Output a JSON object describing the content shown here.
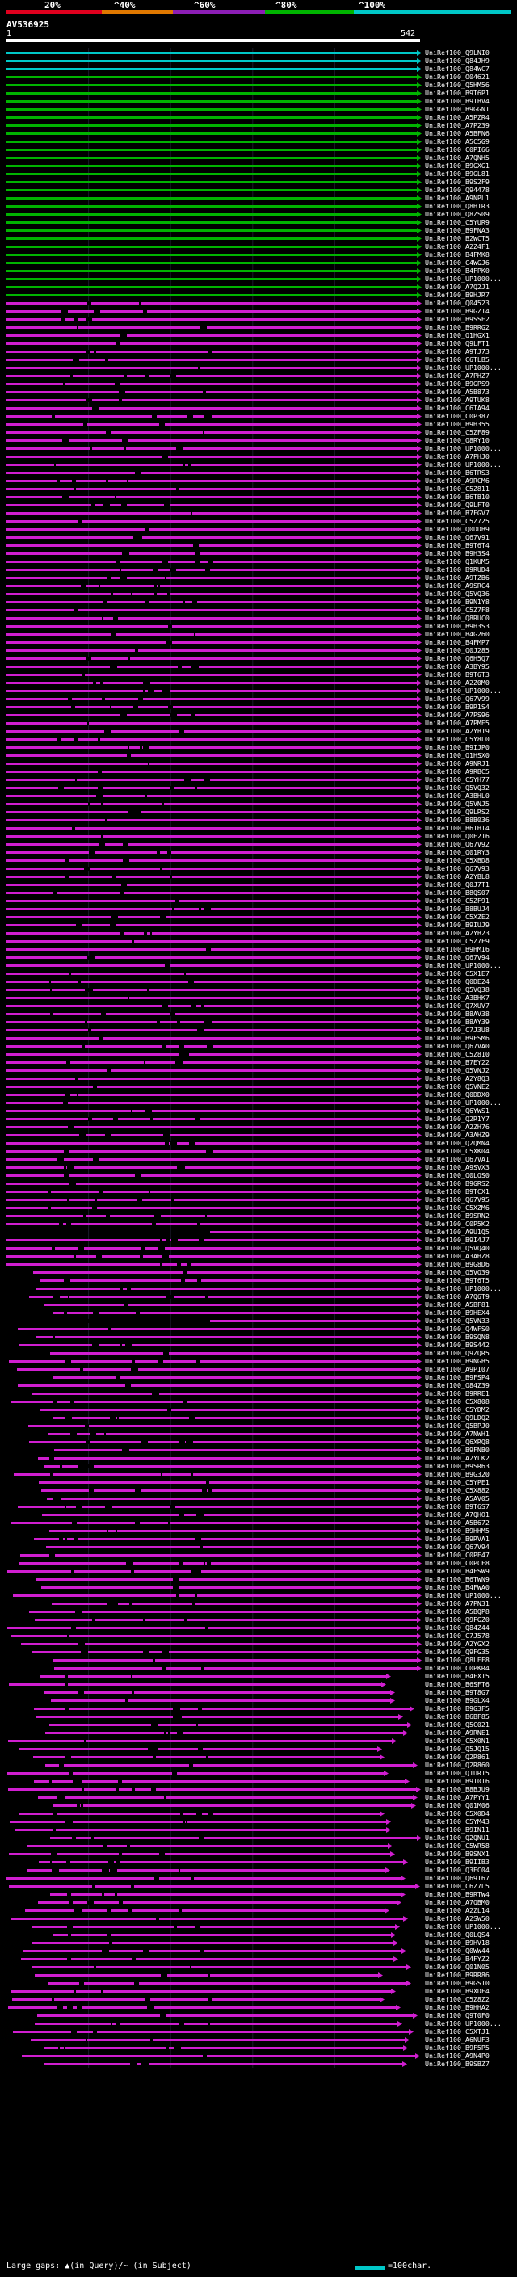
{
  "legend": {
    "labels": [
      "20%",
      "^40%",
      "^60%",
      "^80%",
      "^100%"
    ],
    "colors": [
      "#e0001e",
      "#e07800",
      "#8c1eb4",
      "#00b400",
      "#00c8c8"
    ]
  },
  "query": {
    "id": "AV536925",
    "start": "1",
    "end": "542"
  },
  "hits": [
    {
      "label": "UniRef100_Q9LNI0",
      "color": "cyan"
    },
    {
      "label": "UniRef100_Q84JH9",
      "color": "cyan"
    },
    {
      "label": "UniRef100_Q84WC7",
      "color": "cyan"
    },
    {
      "label": "UniRef100_O04621",
      "color": "green"
    },
    {
      "label": "UniRef100_Q5HM56",
      "color": "green"
    },
    {
      "label": "UniRef100_B9T6P1",
      "color": "green"
    },
    {
      "label": "UniRef100_B9IBV4",
      "color": "green"
    },
    {
      "label": "UniRef100_B9GGN1",
      "color": "green"
    },
    {
      "label": "UniRef100_A5PZR4",
      "color": "green"
    },
    {
      "label": "UniRef100_A7P239",
      "color": "green"
    },
    {
      "label": "UniRef100_A5BFN6",
      "color": "green"
    },
    {
      "label": "UniRef100_A5C5G9",
      "color": "green"
    },
    {
      "label": "UniRef100_C0PI66",
      "color": "green"
    },
    {
      "label": "UniRef100_A7QNH5",
      "color": "green"
    },
    {
      "label": "UniRef100_B9GXG1",
      "color": "green"
    },
    {
      "label": "UniRef100_B9GL81",
      "color": "green"
    },
    {
      "label": "UniRef100_B9S2F9",
      "color": "green"
    },
    {
      "label": "UniRef100_Q94478",
      "color": "green"
    },
    {
      "label": "UniRef100_A9NPL1",
      "color": "green"
    },
    {
      "label": "UniRef100_Q8H1R3",
      "color": "green"
    },
    {
      "label": "UniRef100_Q8ZS09",
      "color": "green"
    },
    {
      "label": "UniRef100_C5YUR9",
      "color": "green"
    },
    {
      "label": "UniRef100_B9FNA3",
      "color": "green"
    },
    {
      "label": "UniRef100_B2WCT5",
      "color": "green"
    },
    {
      "label": "UniRef100_A2Z4F1",
      "color": "green"
    },
    {
      "label": "UniRef100_B4FMK8",
      "color": "green"
    },
    {
      "label": "UniRef100_C4WGJ6",
      "color": "green"
    },
    {
      "label": "UniRef100_B4FPK0",
      "color": "green"
    },
    {
      "label": "UniRef100_UP1000...",
      "color": "green"
    },
    {
      "label": "UniRef100_A7Q2J1",
      "color": "green"
    },
    {
      "label": "UniRef100_B9HJR7",
      "color": "green"
    },
    {
      "label": "UniRef100_Q04523",
      "color": "magenta"
    },
    {
      "label": "UniRef100_B9GZ14",
      "color": "magenta"
    },
    {
      "label": "UniRef100_B9SSE2",
      "color": "magenta"
    },
    {
      "label": "UniRef100_B9RRG2",
      "color": "magenta"
    },
    {
      "label": "UniRef100_Q1HGX1",
      "color": "magenta"
    },
    {
      "label": "UniRef100_Q9LFT1",
      "color": "magenta"
    },
    {
      "label": "UniRef100_A9TJ73",
      "color": "magenta"
    },
    {
      "label": "UniRef100_C6TLB5",
      "color": "magenta"
    },
    {
      "label": "UniRef100_UP1000...",
      "color": "magenta"
    },
    {
      "label": "UniRef100_A7PHZ7",
      "color": "magenta"
    },
    {
      "label": "UniRef100_B9GPS9",
      "color": "magenta"
    },
    {
      "label": "UniRef100_A5B873",
      "color": "magenta"
    },
    {
      "label": "UniRef100_A9TUK8",
      "color": "magenta"
    },
    {
      "label": "UniRef100_C6TA94",
      "color": "magenta"
    },
    {
      "label": "UniRef100_C0P387",
      "color": "magenta"
    },
    {
      "label": "UniRef100_B9H355",
      "color": "magenta"
    },
    {
      "label": "UniRef100_C5ZF89",
      "color": "magenta"
    },
    {
      "label": "UniRef100_Q8RY10",
      "color": "magenta"
    },
    {
      "label": "UniRef100_UP1000...",
      "color": "magenta"
    },
    {
      "label": "UniRef100_A7PHJ0",
      "color": "magenta"
    },
    {
      "label": "UniRef100_UP1000...",
      "color": "magenta"
    },
    {
      "label": "UniRef100_B6TRS3",
      "color": "magenta"
    },
    {
      "label": "UniRef100_A9RCM6",
      "color": "magenta"
    },
    {
      "label": "UniRef100_C5Z811",
      "color": "magenta"
    },
    {
      "label": "UniRef100_B6TB10",
      "color": "magenta"
    },
    {
      "label": "UniRef100_Q9LFT0",
      "color": "magenta"
    },
    {
      "label": "UniRef100_B7FGV7",
      "color": "magenta"
    },
    {
      "label": "UniRef100_C5Z725",
      "color": "magenta"
    },
    {
      "label": "UniRef100_Q0DDB9",
      "color": "magenta"
    },
    {
      "label": "UniRef100_Q67V91",
      "color": "magenta"
    },
    {
      "label": "UniRef100_B9T6T4",
      "color": "magenta"
    },
    {
      "label": "UniRef100_B9H3S4",
      "color": "magenta"
    },
    {
      "label": "UniRef100_Q1KUM5",
      "color": "magenta"
    },
    {
      "label": "UniRef100_B9RUD4",
      "color": "magenta"
    },
    {
      "label": "UniRef100_A9TZB6",
      "color": "magenta"
    },
    {
      "label": "UniRef100_A9SRC4",
      "color": "magenta"
    },
    {
      "label": "UniRef100_Q5VQ36",
      "color": "magenta"
    },
    {
      "label": "UniRef100_B9N1Y8",
      "color": "magenta"
    },
    {
      "label": "UniRef100_C5Z7F8",
      "color": "magenta"
    },
    {
      "label": "UniRef100_Q8RUC0",
      "color": "magenta"
    },
    {
      "label": "UniRef100_B9H3S3",
      "color": "magenta"
    },
    {
      "label": "UniRef100_B4G260",
      "color": "magenta"
    },
    {
      "label": "UniRef100_B4FMP7",
      "color": "magenta"
    },
    {
      "label": "UniRef100_Q0J285",
      "color": "magenta"
    },
    {
      "label": "UniRef100_Q6H5Q7",
      "color": "magenta"
    },
    {
      "label": "UniRef100_A3BY95",
      "color": "magenta"
    },
    {
      "label": "UniRef100_B9T6T3",
      "color": "magenta"
    },
    {
      "label": "UniRef100_A2Z0M0",
      "color": "magenta"
    },
    {
      "label": "UniRef100_UP1000...",
      "color": "magenta"
    },
    {
      "label": "UniRef100_Q67V99",
      "color": "magenta"
    },
    {
      "label": "UniRef100_B9R1S4",
      "color": "magenta"
    },
    {
      "label": "UniRef100_A7PS96",
      "color": "magenta"
    },
    {
      "label": "UniRef100_A7PME5",
      "color": "magenta"
    },
    {
      "label": "UniRef100_A2YB19",
      "color": "magenta"
    },
    {
      "label": "UniRef100_C5Y8L0",
      "color": "magenta"
    },
    {
      "label": "UniRef100_B9IJP0",
      "color": "magenta"
    },
    {
      "label": "UniRef100_Q1HSX0",
      "color": "magenta"
    },
    {
      "label": "UniRef100_A9NRJ1",
      "color": "magenta"
    },
    {
      "label": "UniRef100_A9RBC5",
      "color": "magenta"
    },
    {
      "label": "UniRef100_C5YH77",
      "color": "magenta"
    },
    {
      "label": "UniRef100_Q5VQ32",
      "color": "magenta"
    },
    {
      "label": "UniRef100_A3BHL0",
      "color": "magenta"
    },
    {
      "label": "UniRef100_Q5VNJ5",
      "color": "magenta"
    },
    {
      "label": "UniRef100_Q9LRS2",
      "color": "magenta"
    },
    {
      "label": "UniRef100_B8B036",
      "color": "magenta"
    },
    {
      "label": "UniRef100_B6THT4",
      "color": "magenta"
    },
    {
      "label": "UniRef100_Q0E216",
      "color": "magenta"
    },
    {
      "label": "UniRef100_Q67V92",
      "color": "magenta"
    },
    {
      "label": "UniRef100_Q01RY3",
      "color": "magenta"
    },
    {
      "label": "UniRef100_C5XBD8",
      "color": "magenta"
    },
    {
      "label": "UniRef100_Q67V93",
      "color": "magenta"
    },
    {
      "label": "UniRef100_A2YBL8",
      "color": "magenta"
    },
    {
      "label": "UniRef100_Q0J7T1",
      "color": "magenta"
    },
    {
      "label": "UniRef100_B8QS07",
      "color": "magenta"
    },
    {
      "label": "UniRef100_C5ZF91",
      "color": "magenta"
    },
    {
      "label": "UniRef100_B8BUJ4",
      "color": "magenta"
    },
    {
      "label": "UniRef100_C5XZE2",
      "color": "magenta"
    },
    {
      "label": "UniRef100_B9IUJ9",
      "color": "magenta"
    },
    {
      "label": "UniRef100_A2YB23",
      "color": "magenta"
    },
    {
      "label": "UniRef100_C5Z7F9",
      "color": "magenta"
    },
    {
      "label": "UniRef100_B9HMI6",
      "color": "magenta"
    },
    {
      "label": "UniRef100_Q67V94",
      "color": "magenta"
    },
    {
      "label": "UniRef100_UP1000...",
      "color": "magenta"
    },
    {
      "label": "UniRef100_C5X1E7",
      "color": "magenta"
    },
    {
      "label": "UniRef100_Q0DE24",
      "color": "magenta"
    },
    {
      "label": "UniRef100_Q5VQ38",
      "color": "magenta"
    },
    {
      "label": "UniRef100_A3BHK7",
      "color": "magenta"
    },
    {
      "label": "UniRef100_Q7XUV7",
      "color": "magenta"
    },
    {
      "label": "UniRef100_B8AV38",
      "color": "magenta"
    },
    {
      "label": "UniRef100_B8AY39",
      "color": "magenta"
    },
    {
      "label": "UniRef100_C7J3U8",
      "color": "magenta"
    },
    {
      "label": "UniRef100_B9FSM6",
      "color": "magenta"
    },
    {
      "label": "UniRef100_Q67VA0",
      "color": "magenta"
    },
    {
      "label": "UniRef100_C5Z810",
      "color": "magenta"
    },
    {
      "label": "UniRef100_B7EY22",
      "color": "magenta"
    },
    {
      "label": "UniRef100_Q5VNJ2",
      "color": "magenta"
    },
    {
      "label": "UniRef100_A2Y8Q3",
      "color": "magenta"
    },
    {
      "label": "UniRef100_Q5VNE2",
      "color": "magenta"
    },
    {
      "label": "UniRef100_Q0DDX0",
      "color": "magenta"
    },
    {
      "label": "UniRef100_UP1000...",
      "color": "magenta"
    },
    {
      "label": "UniRef100_Q6YWS1",
      "color": "magenta"
    },
    {
      "label": "UniRef100_Q2R1Y7",
      "color": "magenta"
    },
    {
      "label": "UniRef100_A2ZH76",
      "color": "magenta"
    },
    {
      "label": "UniRef100_A3AHZ9",
      "color": "magenta"
    },
    {
      "label": "UniRef100_Q2QMN4",
      "color": "magenta"
    },
    {
      "label": "UniRef100_C5XK04",
      "color": "magenta"
    },
    {
      "label": "UniRef100_Q67VA1",
      "color": "magenta"
    },
    {
      "label": "UniRef100_A9SVX3",
      "color": "magenta"
    },
    {
      "label": "UniRef100_Q0LQS0",
      "color": "magenta"
    },
    {
      "label": "UniRef100_B9GRS2",
      "color": "magenta"
    },
    {
      "label": "UniRef100_B9TCX1",
      "color": "magenta"
    },
    {
      "label": "UniRef100_Q67V95",
      "color": "magenta"
    },
    {
      "label": "UniRef100_C5XZM6",
      "color": "magenta"
    },
    {
      "label": "UniRef100_B9SRN2",
      "color": "magenta"
    },
    {
      "label": "UniRef100_C0P5K2",
      "color": "magenta"
    },
    {
      "label": "UniRef100_A9U1Q5",
      "color": "magenta"
    },
    {
      "label": "UniRef100_B9I4J7",
      "color": "magenta"
    },
    {
      "label": "UniRef100_Q5VQ40",
      "color": "magenta"
    },
    {
      "label": "UniRef100_A3AHZ8",
      "color": "magenta"
    },
    {
      "label": "UniRef100_B9G8D6",
      "color": "magenta"
    },
    {
      "label": "UniRef100_Q5VQ39",
      "color": "magenta"
    },
    {
      "label": "UniRef100_B9T6T5",
      "color": "magenta"
    },
    {
      "label": "UniRef100_UP1000...",
      "color": "magenta"
    },
    {
      "label": "UniRef100_A7Q6T9",
      "color": "magenta"
    },
    {
      "label": "UniRef100_A5BF81",
      "color": "magenta"
    },
    {
      "label": "UniRef100_B9HEX4",
      "color": "magenta"
    },
    {
      "label": "UniRef100_Q5VN33",
      "color": "magenta"
    },
    {
      "label": "UniRef100_Q4WFS0",
      "color": "magenta"
    },
    {
      "label": "UniRef100_B9SQN8",
      "color": "magenta"
    },
    {
      "label": "UniRef100_B9S442",
      "color": "magenta"
    },
    {
      "label": "UniRef100_Q9ZQR5",
      "color": "magenta"
    },
    {
      "label": "UniRef100_B9NGB5",
      "color": "magenta"
    },
    {
      "label": "UniRef100_A9PI07",
      "color": "magenta"
    },
    {
      "label": "UniRef100_B9FSP4",
      "color": "magenta"
    },
    {
      "label": "UniRef100_Q84Z39",
      "color": "magenta"
    },
    {
      "label": "UniRef100_B9RRE1",
      "color": "magenta"
    },
    {
      "label": "UniRef100_C5X808",
      "color": "magenta"
    },
    {
      "label": "UniRef100_C5YDM2",
      "color": "magenta"
    },
    {
      "label": "UniRef100_Q9LDQ2",
      "color": "magenta"
    },
    {
      "label": "UniRef100_Q5BPJ0",
      "color": "magenta"
    },
    {
      "label": "UniRef100_A7NWH1",
      "color": "magenta"
    },
    {
      "label": "UniRef100_Q6XRQ8",
      "color": "magenta"
    },
    {
      "label": "UniRef100_B9FNB0",
      "color": "magenta"
    },
    {
      "label": "UniRef100_A2YLK2",
      "color": "magenta"
    },
    {
      "label": "UniRef100_B9SR63",
      "color": "magenta"
    },
    {
      "label": "UniRef100_B9G320",
      "color": "magenta"
    },
    {
      "label": "UniRef100_C5YPE1",
      "color": "magenta"
    },
    {
      "label": "UniRef100_C5X882",
      "color": "magenta"
    },
    {
      "label": "UniRef100_A5AV05",
      "color": "magenta"
    },
    {
      "label": "UniRef100_B9T6S7",
      "color": "magenta"
    },
    {
      "label": "UniRef100_A7QHO1",
      "color": "magenta"
    },
    {
      "label": "UniRef100_A5B672",
      "color": "magenta"
    },
    {
      "label": "UniRef100_B9HHM5",
      "color": "magenta"
    },
    {
      "label": "UniRef100_B9RVA1",
      "color": "magenta"
    },
    {
      "label": "UniRef100_Q67V94",
      "color": "magenta"
    },
    {
      "label": "UniRef100_C0PE47",
      "color": "magenta"
    },
    {
      "label": "UniRef100_C0PCF8",
      "color": "magenta"
    },
    {
      "label": "UniRef100_B4FSW9",
      "color": "magenta"
    },
    {
      "label": "UniRef100_B6TWN9",
      "color": "magenta"
    },
    {
      "label": "UniRef100_B4FWA0",
      "color": "magenta"
    },
    {
      "label": "UniRef100_UP1000...",
      "color": "magenta"
    },
    {
      "label": "UniRef100_A7PN31",
      "color": "magenta"
    },
    {
      "label": "UniRef100_A5BQP8",
      "color": "magenta"
    },
    {
      "label": "UniRef100_Q9FGZ0",
      "color": "magenta"
    },
    {
      "label": "UniRef100_Q84Z44",
      "color": "magenta"
    },
    {
      "label": "UniRef100_C7J578",
      "color": "magenta"
    },
    {
      "label": "UniRef100_A2YGX2",
      "color": "magenta"
    },
    {
      "label": "UniRef100_Q9FG35",
      "color": "magenta"
    },
    {
      "label": "UniRef100_Q8LEF8",
      "color": "magenta"
    },
    {
      "label": "UniRef100_C0PKR4",
      "color": "magenta"
    },
    {
      "label": "UniRef100_B4FX15",
      "color": "magenta"
    },
    {
      "label": "UniRef100_B6SFT6",
      "color": "magenta"
    },
    {
      "label": "UniRef100_B9T8G7",
      "color": "magenta"
    },
    {
      "label": "UniRef100_B9GLX4",
      "color": "magenta"
    },
    {
      "label": "UniRef100_B9G3F5",
      "color": "magenta"
    },
    {
      "label": "UniRef100_B6BF85",
      "color": "magenta"
    },
    {
      "label": "UniRef100_Q5C021",
      "color": "magenta"
    },
    {
      "label": "UniRef100_A9RNE1",
      "color": "magenta"
    },
    {
      "label": "UniRef100_C5X0N1",
      "color": "magenta"
    },
    {
      "label": "UniRef100_Q5JQ15",
      "color": "magenta"
    },
    {
      "label": "UniRef100_Q2R861",
      "color": "magenta"
    },
    {
      "label": "UniRef100_Q2R860",
      "color": "magenta"
    },
    {
      "label": "UniRef100_Q1UR15",
      "color": "magenta"
    },
    {
      "label": "UniRef100_B9T0T6",
      "color": "magenta"
    },
    {
      "label": "UniRef100_B8BJU9",
      "color": "magenta"
    },
    {
      "label": "UniRef100_A7PYY1",
      "color": "magenta"
    },
    {
      "label": "UniRef100_Q01M06",
      "color": "magenta"
    },
    {
      "label": "UniRef100_C5X0D4",
      "color": "magenta"
    },
    {
      "label": "UniRef100_C5YM43",
      "color": "magenta"
    },
    {
      "label": "UniRef100_B9IN11",
      "color": "magenta"
    },
    {
      "label": "UniRef100_Q2QNU1",
      "color": "magenta"
    },
    {
      "label": "UniRef100_C5WR58",
      "color": "magenta"
    },
    {
      "label": "UniRef100_B9SNX1",
      "color": "magenta"
    },
    {
      "label": "UniRef100_B9IIB3",
      "color": "magenta"
    },
    {
      "label": "UniRef100_Q3EC04",
      "color": "magenta"
    },
    {
      "label": "UniRef100_Q69T67",
      "color": "magenta"
    },
    {
      "label": "UniRef100_C6Z7L5",
      "color": "magenta"
    },
    {
      "label": "UniRef100_B9RTW4",
      "color": "magenta"
    },
    {
      "label": "UniRef100_A7QBM0",
      "color": "magenta"
    },
    {
      "label": "UniRef100_A2ZL14",
      "color": "magenta"
    },
    {
      "label": "UniRef100_A2SW50",
      "color": "magenta"
    },
    {
      "label": "UniRef100_UP1000...",
      "color": "magenta"
    },
    {
      "label": "UniRef100_Q0LQS4",
      "color": "magenta"
    },
    {
      "label": "UniRef100_B9HV18",
      "color": "magenta"
    },
    {
      "label": "UniRef100_Q0WW44",
      "color": "magenta"
    },
    {
      "label": "UniRef100_B4FYZ2",
      "color": "magenta"
    },
    {
      "label": "UniRef100_Q01N05",
      "color": "magenta"
    },
    {
      "label": "UniRef100_B9RR86",
      "color": "magenta"
    },
    {
      "label": "UniRef100_B9GST0",
      "color": "magenta"
    },
    {
      "label": "UniRef100_B9XDF4",
      "color": "magenta"
    },
    {
      "label": "UniRef100_C5Z8Z2",
      "color": "magenta"
    },
    {
      "label": "UniRef100_B9HHA2",
      "color": "magenta"
    },
    {
      "label": "UniRef100_Q9T0F0",
      "color": "magenta"
    },
    {
      "label": "UniRef100_UP1000...",
      "color": "magenta"
    },
    {
      "label": "UniRef100_C5XTJ1",
      "color": "magenta"
    },
    {
      "label": "UniRef100_A6NUF3",
      "color": "magenta"
    },
    {
      "label": "UniRef100_B9F5P5",
      "color": "magenta"
    },
    {
      "label": "UniRef100_A9N4P0",
      "color": "magenta"
    },
    {
      "label": "UniRef100_B9SBZ7",
      "color": "magenta"
    }
  ],
  "footer": {
    "gap_text": "Large gaps: ▲(in Query)/~ (in Subject)",
    "scale_text": "=100char."
  }
}
